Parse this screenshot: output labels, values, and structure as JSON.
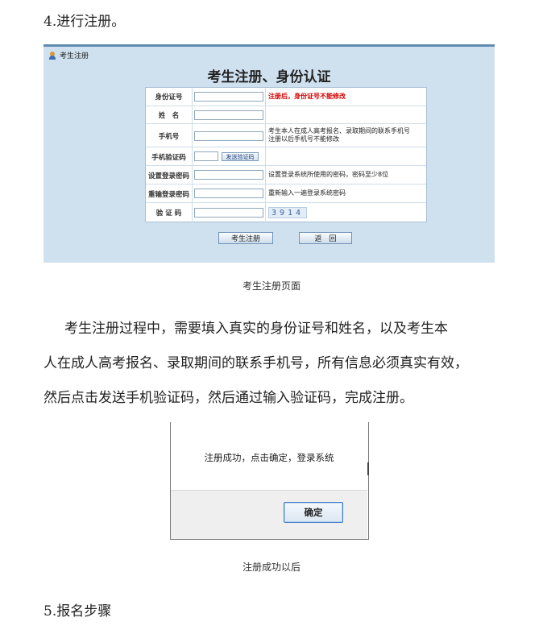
{
  "doc": {
    "heading_step4": "4.进行注册。",
    "caption_register": "考生注册页面",
    "paragraph_lines": [
      "考生注册过程中，需要填入真实的身份证号和姓名，以及考生本",
      "人在成人高考报名、录取期间的联系手机号，所有信息必须真实有效，",
      "然后点击发送手机验证码，然后通过输入验证码，完成注册。"
    ],
    "caption_success": "注册成功以后",
    "heading_step5": "5.报名步骤"
  },
  "register": {
    "panel_title": "考生注册",
    "form_title": "考生注册、身份认证",
    "rows": [
      {
        "label": "身份证号",
        "hint": "注册后，身份证号不能修改"
      },
      {
        "label": "姓　名"
      },
      {
        "label": "手机号",
        "hint_line1": "考生本人在成人高考报名、录取期间的联系手机号",
        "hint_line2": "注册以后手机号不能修改"
      },
      {
        "label": "手机验证码",
        "button": "发送验证码"
      },
      {
        "label": "设置登录密码",
        "hint": "设置登录系统所使用的密码，密码至少8位"
      },
      {
        "label": "重输登录密码",
        "hint": "重新输入一遍登录系统密码"
      },
      {
        "label": "验 证 码",
        "captcha": "3914"
      }
    ],
    "submit_label": "考生注册",
    "back_label": "返　回"
  },
  "dialog": {
    "message": "注册成功，点击确定，登录系统",
    "ok_label": "确定"
  },
  "colors": {
    "panel_bg": "#cfe0ee",
    "panel_border": "#5f8ab2",
    "hint_red": "#d40000",
    "button_border_blue": "#3d7bc5"
  }
}
